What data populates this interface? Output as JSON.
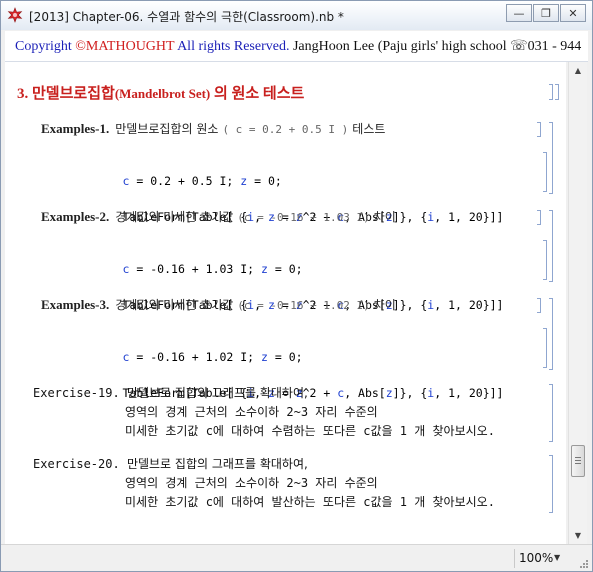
{
  "window": {
    "title": "[2013] Chapter-06. 수열과 함수의 극한(Classroom).nb *",
    "minimize_glyph": "—",
    "restore_glyph": "❐",
    "close_glyph": "✕",
    "icon": "mathematica-spikey-icon"
  },
  "banner": {
    "copyright": "Copyright",
    "mark": "©",
    "brand": "MATHOUGHT",
    "rights": " All rights Reserved.",
    "author": "JangHoon Lee (Paju girls' high school",
    "phone": "☏031 - 944"
  },
  "section": {
    "number": "3.",
    "title_ko": "만델브로집합",
    "title_en": "(Mandelbrot Set)",
    "title_tail": "의 원소 테스트"
  },
  "examples": [
    {
      "label": "Examples-1.",
      "desc": "만델브로집합의 원소",
      "param": "( c = 0.2 + 0.5 I )",
      "tail": "테스트",
      "code": [
        "c = 0.2 + 0.5 I; z = 0;",
        "TableForm[Table[ {i, z = z^2 + c, Abs[z]}, {i, 1, 20}]]"
      ]
    },
    {
      "label": "Examples-2.",
      "desc": "경계값의 미세한 초기값",
      "param": "(c = -0.16 + 1.03 I)",
      "tail": "차이",
      "code": [
        "c = -0.16 + 1.03 I; z = 0;",
        "TableForm[Table[ {i, z = z^2 + c, Abs[z]}, {i, 1, 20}]]"
      ]
    },
    {
      "label": "Examples-3.",
      "desc": "경계값의 미세한 초기값",
      "param": "(c = -0.16 + 1.02 I)",
      "tail": "차이",
      "code": [
        "c = -0.16 + 1.02 I; z = 0;",
        "TableForm[Table[ {i, z = z^2 + c, Abs[z]}, {i, 1, 20}]]"
      ]
    }
  ],
  "exercises": [
    {
      "label": "Exercise-19.",
      "lines": [
        "만델브로 집합의 그래프를 확대하여,",
        "영역의 경계 근처의 소수이하 2~3 자리 수준의",
        "미세한 초기값 c에 대하여 수렴하는 또다른 c값을 1 개 찾아보시오."
      ]
    },
    {
      "label": "Exercise-20.",
      "lines": [
        "만델브로 집합의 그래프를 확대하여,",
        "영역의 경계 근처의 소수이하 2~3 자리 수준의",
        "미세한 초기값 c에 대하여 발산하는 또다른 c값을 1 개 찾아보시오."
      ]
    }
  ],
  "statusbar": {
    "zoom": "100%"
  },
  "colors": {
    "section_red": "#c8201e",
    "banner_blue": "#1a1fb7",
    "variable_blue": "#1e3fd0",
    "bracket_blue": "#8fa6d0"
  }
}
